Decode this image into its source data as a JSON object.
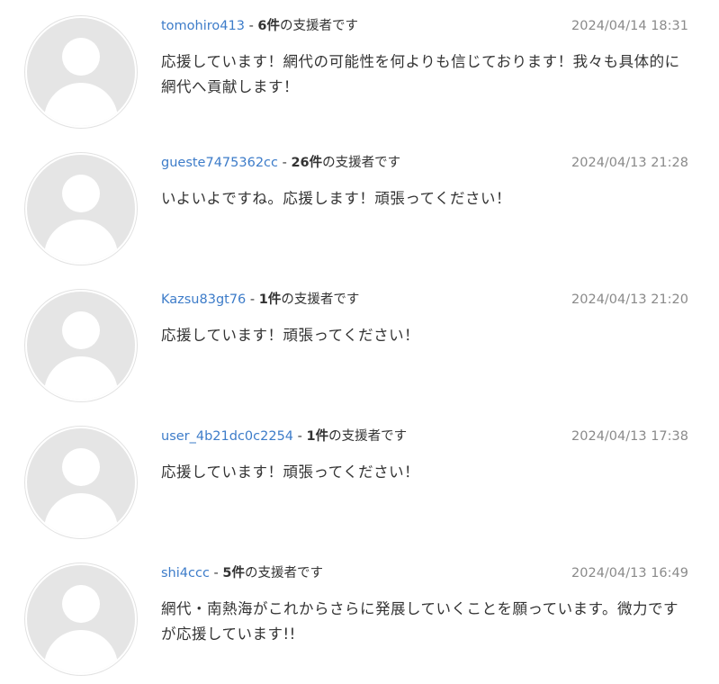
{
  "comments": [
    {
      "username": "tomohiro413",
      "separator": " - ",
      "count": "6件",
      "supporter_label": "の支援者です",
      "timestamp": "2024/04/14 18:31",
      "text": "応援しています！網代の可能性を何よりも信じております！我々も具体的に網代へ貢献します！"
    },
    {
      "username": "gueste7475362cc",
      "separator": " - ",
      "count": "26件",
      "supporter_label": "の支援者です",
      "timestamp": "2024/04/13 21:28",
      "text": "いよいよですね。応援します！頑張ってください！"
    },
    {
      "username": "Kazsu83gt76",
      "separator": " - ",
      "count": "1件",
      "supporter_label": "の支援者です",
      "timestamp": "2024/04/13 21:20",
      "text": "応援しています！頑張ってください！"
    },
    {
      "username": "user_4b21dc0c2254",
      "separator": " - ",
      "count": "1件",
      "supporter_label": "の支援者です",
      "timestamp": "2024/04/13 17:38",
      "text": "応援しています！頑張ってください！"
    },
    {
      "username": "shi4ccc",
      "separator": " - ",
      "count": "5件",
      "supporter_label": "の支援者です",
      "timestamp": "2024/04/13 16:49",
      "text": "網代・南熱海がこれからさらに発展していくことを願っています。微力ですが応援しています!!"
    }
  ],
  "colors": {
    "username_link": "#3d7cc9",
    "timestamp": "#8a8a8a",
    "text": "#333333",
    "avatar_bg": "#e5e5e5"
  },
  "icons": {
    "avatar": "default-user-avatar-icon"
  }
}
